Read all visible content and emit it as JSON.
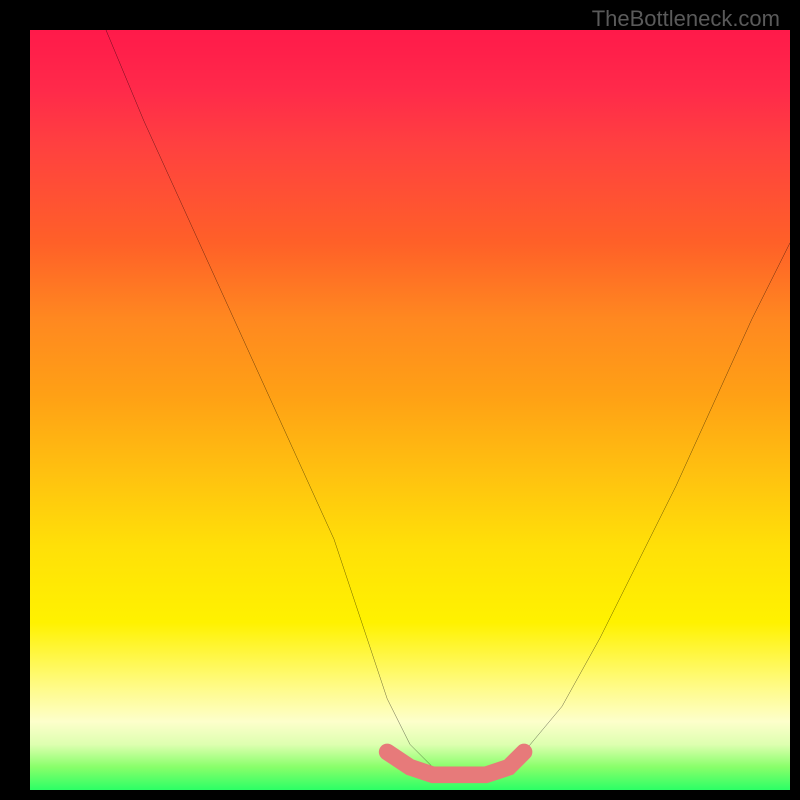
{
  "watermark": "TheBottleneck.com",
  "chart_data": {
    "type": "line",
    "title": "",
    "xlabel": "",
    "ylabel": "",
    "xlim": [
      0,
      100
    ],
    "ylim": [
      0,
      100
    ],
    "series": [
      {
        "name": "main-curve",
        "color": "#000000",
        "x": [
          10,
          15,
          20,
          25,
          30,
          35,
          40,
          45,
          47,
          50,
          53,
          55,
          58,
          60,
          63,
          65,
          70,
          75,
          80,
          85,
          90,
          95,
          100
        ],
        "y": [
          100,
          88,
          77,
          66,
          55,
          44,
          33,
          18,
          12,
          6,
          3,
          2,
          2,
          2,
          3,
          5,
          11,
          20,
          30,
          40,
          51,
          62,
          72
        ]
      },
      {
        "name": "bottom-band",
        "color": "#e77a7a",
        "x": [
          47,
          50,
          53,
          55,
          58,
          60,
          63,
          65
        ],
        "y": [
          5,
          3,
          2,
          2,
          2,
          2,
          3,
          5
        ]
      }
    ]
  }
}
